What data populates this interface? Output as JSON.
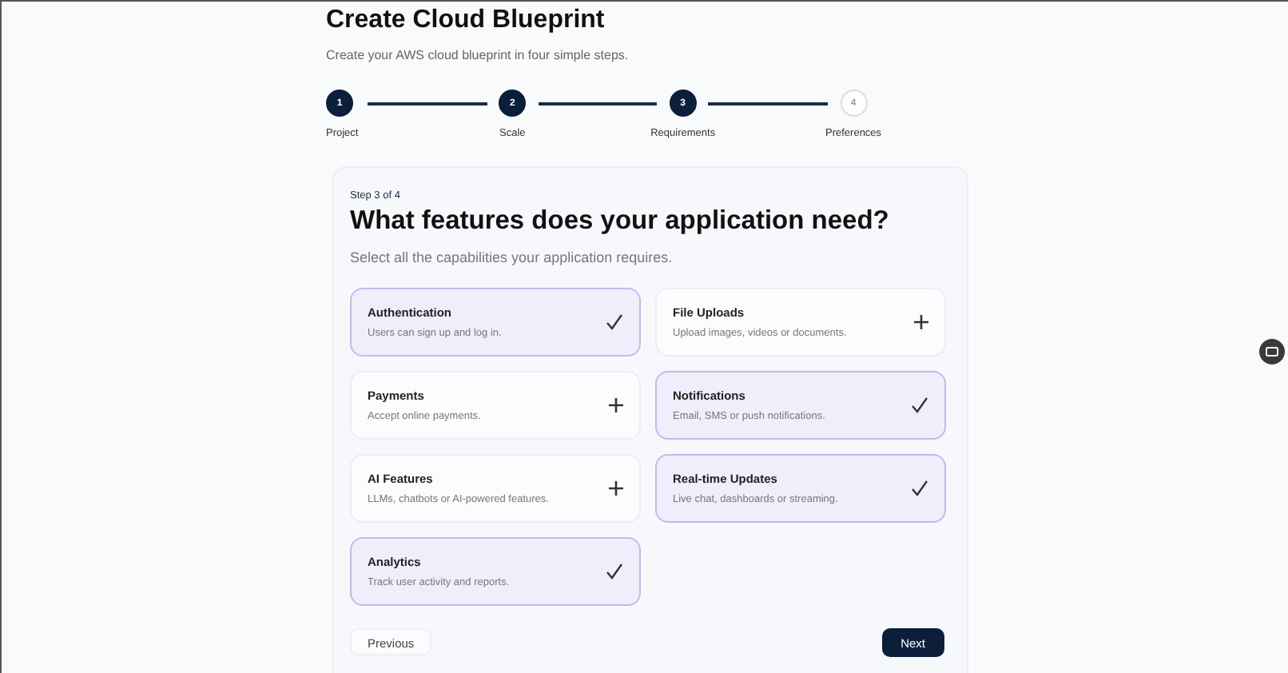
{
  "header": {
    "title": "Create Cloud Blueprint",
    "subtitle": "Create your AWS cloud blueprint in four simple steps."
  },
  "steps": [
    {
      "number": "1",
      "label": "Project",
      "done": true
    },
    {
      "number": "2",
      "label": "Scale",
      "done": true
    },
    {
      "number": "3",
      "label": "Requirements",
      "done": true
    },
    {
      "number": "4",
      "label": "Preferences",
      "done": false
    }
  ],
  "card": {
    "step_label": "Step 3 of 4",
    "heading": "What features does your application need?",
    "description": "Select all the capabilities your application requires.",
    "options": [
      {
        "title": "Authentication",
        "description": "Users can sign up and log in.",
        "selected": true
      },
      {
        "title": "File Uploads",
        "description": "Upload images, videos or documents.",
        "selected": false
      },
      {
        "title": "Payments",
        "description": "Accept online payments.",
        "selected": false
      },
      {
        "title": "Notifications",
        "description": "Email, SMS or push notifications.",
        "selected": true
      },
      {
        "title": "AI Features",
        "description": "LLMs, chatbots or AI-powered features.",
        "selected": false
      },
      {
        "title": "Real-time Updates",
        "description": "Live chat, dashboards or streaming.",
        "selected": true
      },
      {
        "title": "Analytics",
        "description": "Track user activity and reports.",
        "selected": true
      }
    ],
    "buttons": {
      "previous": "Previous",
      "next": "Next"
    }
  }
}
